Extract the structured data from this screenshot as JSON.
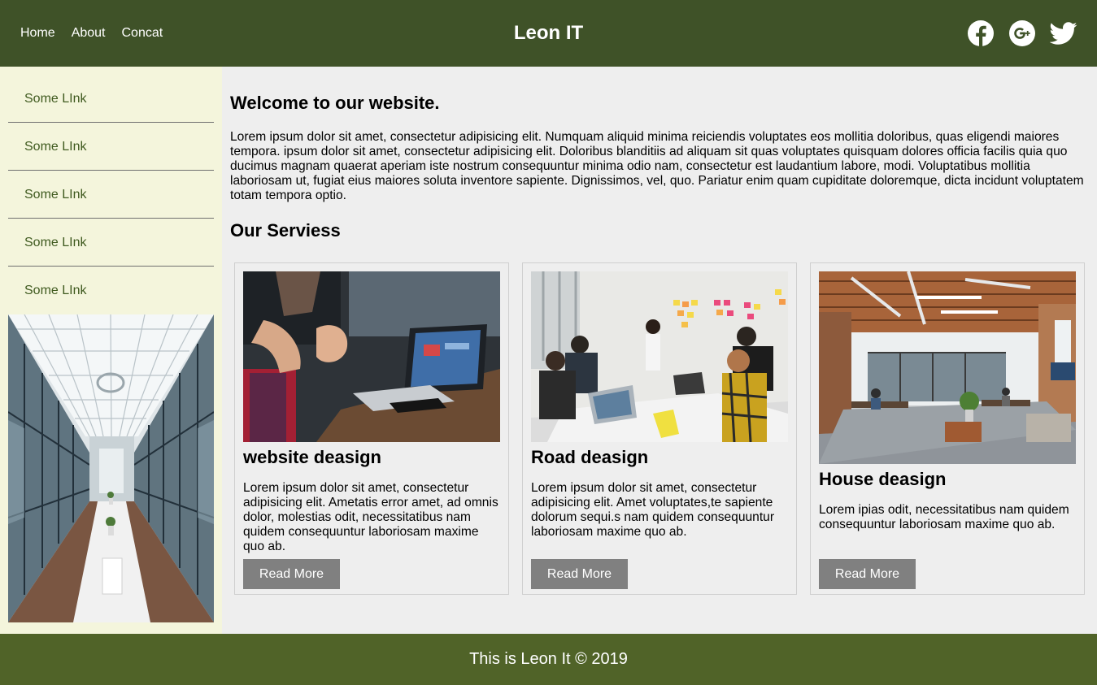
{
  "header": {
    "nav": [
      "Home",
      "About",
      "Concat"
    ],
    "brand": "Leon IT",
    "social_icons": [
      "facebook-icon",
      "google-plus-icon",
      "twitter-icon"
    ]
  },
  "sidebar": {
    "links": [
      "Some LInk",
      "Some LInk",
      "Some LInk",
      "Some LInk",
      "Some LInk"
    ]
  },
  "main": {
    "welcome_title": "Welcome to our website.",
    "intro": "Lorem ipsum dolor sit amet, consectetur adipisicing elit. Numquam aliquid minima reiciendis voluptates eos mollitia doloribus, quas eligendi maiores tempora. ipsum dolor sit amet, consectetur adipisicing elit. Doloribus blanditiis ad aliquam sit quas voluptates quisquam dolores officia facilis quia quo ducimus magnam quaerat aperiam iste nostrum consequuntur minima odio nam, consectetur est laudantium labore, modi. Voluptatibus mollitia laboriosam ut, fugiat eius maiores soluta inventore sapiente. Dignissimos, vel, quo. Pariatur enim quam cupiditate doloremque, dicta incidunt voluptatem totam tempora optio.",
    "services_title": "Our Serviess",
    "cards": [
      {
        "title": "website deasign",
        "text": "Lorem ipsum dolor sit amet, consectetur adipisicing elit. Ametatis error amet, ad omnis dolor, molestias odit, necessitatibus nam quidem consequuntur laboriosam maxime quo ab.",
        "button": "Read More"
      },
      {
        "title": "Road deasign",
        "text": "Lorem ipsum dolor sit amet, consectetur adipisicing elit. Amet voluptates,te sapiente dolorum sequi.s nam quidem consequuntur laboriosam maxime quo ab.",
        "button": "Read More"
      },
      {
        "title": "House deasign",
        "text": "Lorem ipias odit, necessitatibus nam quidem consequuntur laboriosam maxime quo ab.",
        "button": "Read More"
      }
    ]
  },
  "footer": {
    "text": "This is Leon It © 2019"
  },
  "colors": {
    "header_bg": "#3f5228",
    "footer_bg": "#506328",
    "sidebar_bg": "#f4f5dc",
    "sidebar_link": "#3f5a1f",
    "main_bg": "#eeeeee",
    "button_bg": "#808080"
  }
}
